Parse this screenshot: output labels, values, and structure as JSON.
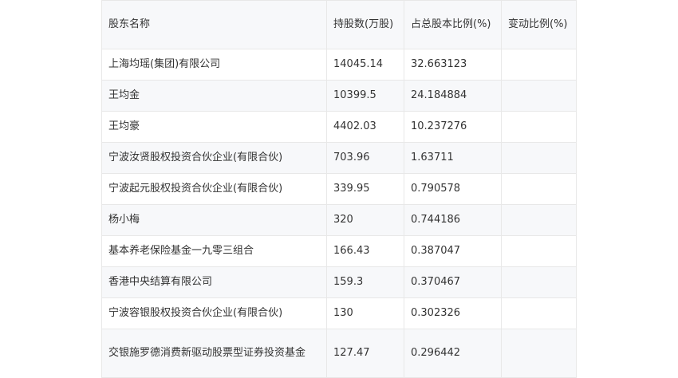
{
  "table": {
    "headers": [
      "股东名称",
      "持股数(万股)",
      "占总股本比例(%)",
      "变动比例(%)"
    ],
    "rows": [
      [
        "上海均瑶(集团)有限公司",
        "14045.14",
        "32.663123",
        ""
      ],
      [
        "王均金",
        "10399.5",
        "24.184884",
        ""
      ],
      [
        "王均豪",
        "4402.03",
        "10.237276",
        ""
      ],
      [
        "宁波汝贤股权投资合伙企业(有限合伙)",
        "703.96",
        "1.63711",
        ""
      ],
      [
        "宁波起元股权投资合伙企业(有限合伙)",
        "339.95",
        "0.790578",
        ""
      ],
      [
        "杨小梅",
        "320",
        "0.744186",
        ""
      ],
      [
        "基本养老保险基金一九零三组合",
        "166.43",
        "0.387047",
        ""
      ],
      [
        "香港中央结算有限公司",
        "159.3",
        "0.370467",
        ""
      ],
      [
        "宁波容银股权投资合伙企业(有限合伙)",
        "130",
        "0.302326",
        ""
      ],
      [
        "交银施罗德消费新驱动股票型证券投资基金",
        "127.47",
        "0.296442",
        ""
      ]
    ]
  }
}
